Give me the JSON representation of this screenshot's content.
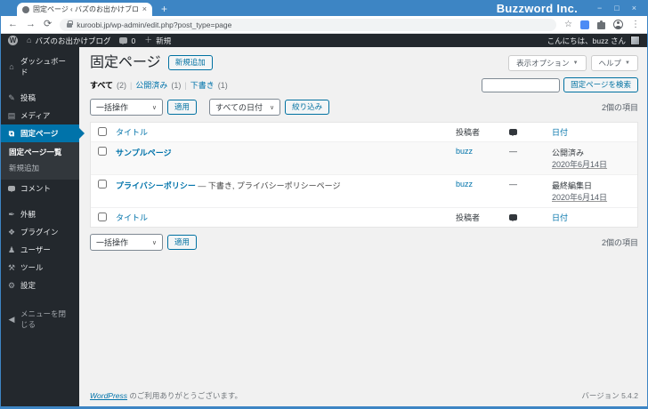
{
  "colors": {
    "accent": "#0073aa",
    "titlebar_blue": "#3d85c4",
    "admin_dark": "#23282d",
    "content_bg": "#f1f1f1"
  },
  "icons": {
    "tab_close": "×",
    "new_tab": "+",
    "minimize": "−",
    "maximize": "□",
    "close": "×",
    "back": "←",
    "forward": "→",
    "reload": "⟳",
    "star": "☆",
    "menu": "⋮",
    "wp": "W",
    "home": "⌂",
    "plus": "＋",
    "chevron_down": "▼",
    "select_chevron": "∨",
    "dashboard": "⌂",
    "posts": "✎",
    "media": "▤",
    "pages": "⧉",
    "appearance": "✒",
    "plugins": "❖",
    "users": "♟",
    "tools": "⚒",
    "settings": "⚙",
    "collapse": "◀"
  },
  "browser": {
    "tab_title": "固定ページ ‹ バズのお出かけブログ —",
    "brand": "Buzzword Inc.",
    "url": "kuroobi.jp/wp-admin/edit.php?post_type=page"
  },
  "admin_bar": {
    "site_name": "バズのお出かけブログ",
    "comment_count": "0",
    "new_label": "新規",
    "greeting": "こんにちは、buzz さん"
  },
  "sidebar": {
    "dashboard": "ダッシュボード",
    "posts": "投稿",
    "media": "メディア",
    "pages": "固定ページ",
    "pages_sub_list": "固定ページ一覧",
    "pages_sub_new": "新規追加",
    "comments": "コメント",
    "appearance": "外観",
    "plugins": "プラグイン",
    "users": "ユーザー",
    "tools": "ツール",
    "settings": "設定",
    "collapse": "メニューを閉じる"
  },
  "page": {
    "title": "固定ページ",
    "add_new_label": "新規追加",
    "screen_options_label": "表示オプション",
    "help_label": "ヘルプ",
    "search_button_label": "固定ページを検索",
    "filter_separator": "|",
    "filters": [
      {
        "label": "すべて",
        "count": "(2)",
        "current": true
      },
      {
        "label": "公開済み",
        "count": "(1)"
      },
      {
        "label": "下書き",
        "count": "(1)"
      }
    ],
    "bulk_action_label": "一括操作",
    "apply_label": "適用",
    "date_filter_label": "すべての日付",
    "filter_button_label": "絞り込み",
    "items_count": "2個の項目",
    "table": {
      "headers": {
        "title": "タイトル",
        "author": "投稿者",
        "date": "日付"
      },
      "rows": [
        {
          "title": "サンプルページ",
          "states": "",
          "author": "buzz",
          "comments": "—",
          "status": "公開済み",
          "date": "2020年6月14日"
        },
        {
          "title": "プライバシーポリシー",
          "states": "— 下書き, プライバシーポリシーページ",
          "author": "buzz",
          "comments": "—",
          "status": "最終編集日",
          "date": "2020年6月14日"
        }
      ]
    }
  },
  "footer": {
    "link": "WordPress",
    "thanks": " のご利用ありがとうございます。",
    "version": "バージョン 5.4.2"
  }
}
